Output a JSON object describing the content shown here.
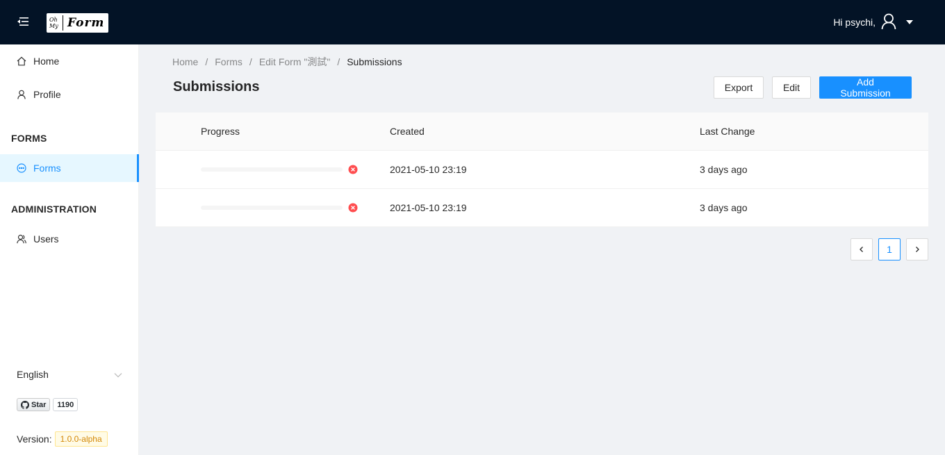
{
  "header": {
    "logo_small": "Oh My",
    "logo_big": "Form",
    "greeting": "Hi psychi,"
  },
  "sidebar": {
    "items": [
      {
        "label": "Home",
        "icon": "home-icon"
      },
      {
        "label": "Profile",
        "icon": "user-icon"
      }
    ],
    "forms_group": "FORMS",
    "forms_item": {
      "label": "Forms",
      "icon": "message-icon"
    },
    "admin_group": "ADMINISTRATION",
    "admin_item": {
      "label": "Users",
      "icon": "team-icon"
    },
    "language": "English",
    "github": {
      "star_label": "Star",
      "count": "1190"
    },
    "version_label": "Version:",
    "version": "1.0.0-alpha"
  },
  "breadcrumb": [
    "Home",
    "Forms",
    "Edit Form \"測試\"",
    "Submissions"
  ],
  "page": {
    "title": "Submissions",
    "export_label": "Export",
    "edit_label": "Edit",
    "add_label": "Add Submission"
  },
  "table": {
    "columns": [
      "Progress",
      "Created",
      "Last Change"
    ],
    "rows": [
      {
        "progress": 0,
        "status": "exception",
        "created": "2021-05-10 23:19",
        "last_change": "3 days ago"
      },
      {
        "progress": 0,
        "status": "exception",
        "created": "2021-05-10 23:19",
        "last_change": "3 days ago"
      }
    ]
  },
  "pagination": {
    "current": "1"
  },
  "colors": {
    "header_bg": "#031326",
    "accent": "#1890ff",
    "error": "#ff4d4f",
    "version_tag": "#d48806"
  }
}
